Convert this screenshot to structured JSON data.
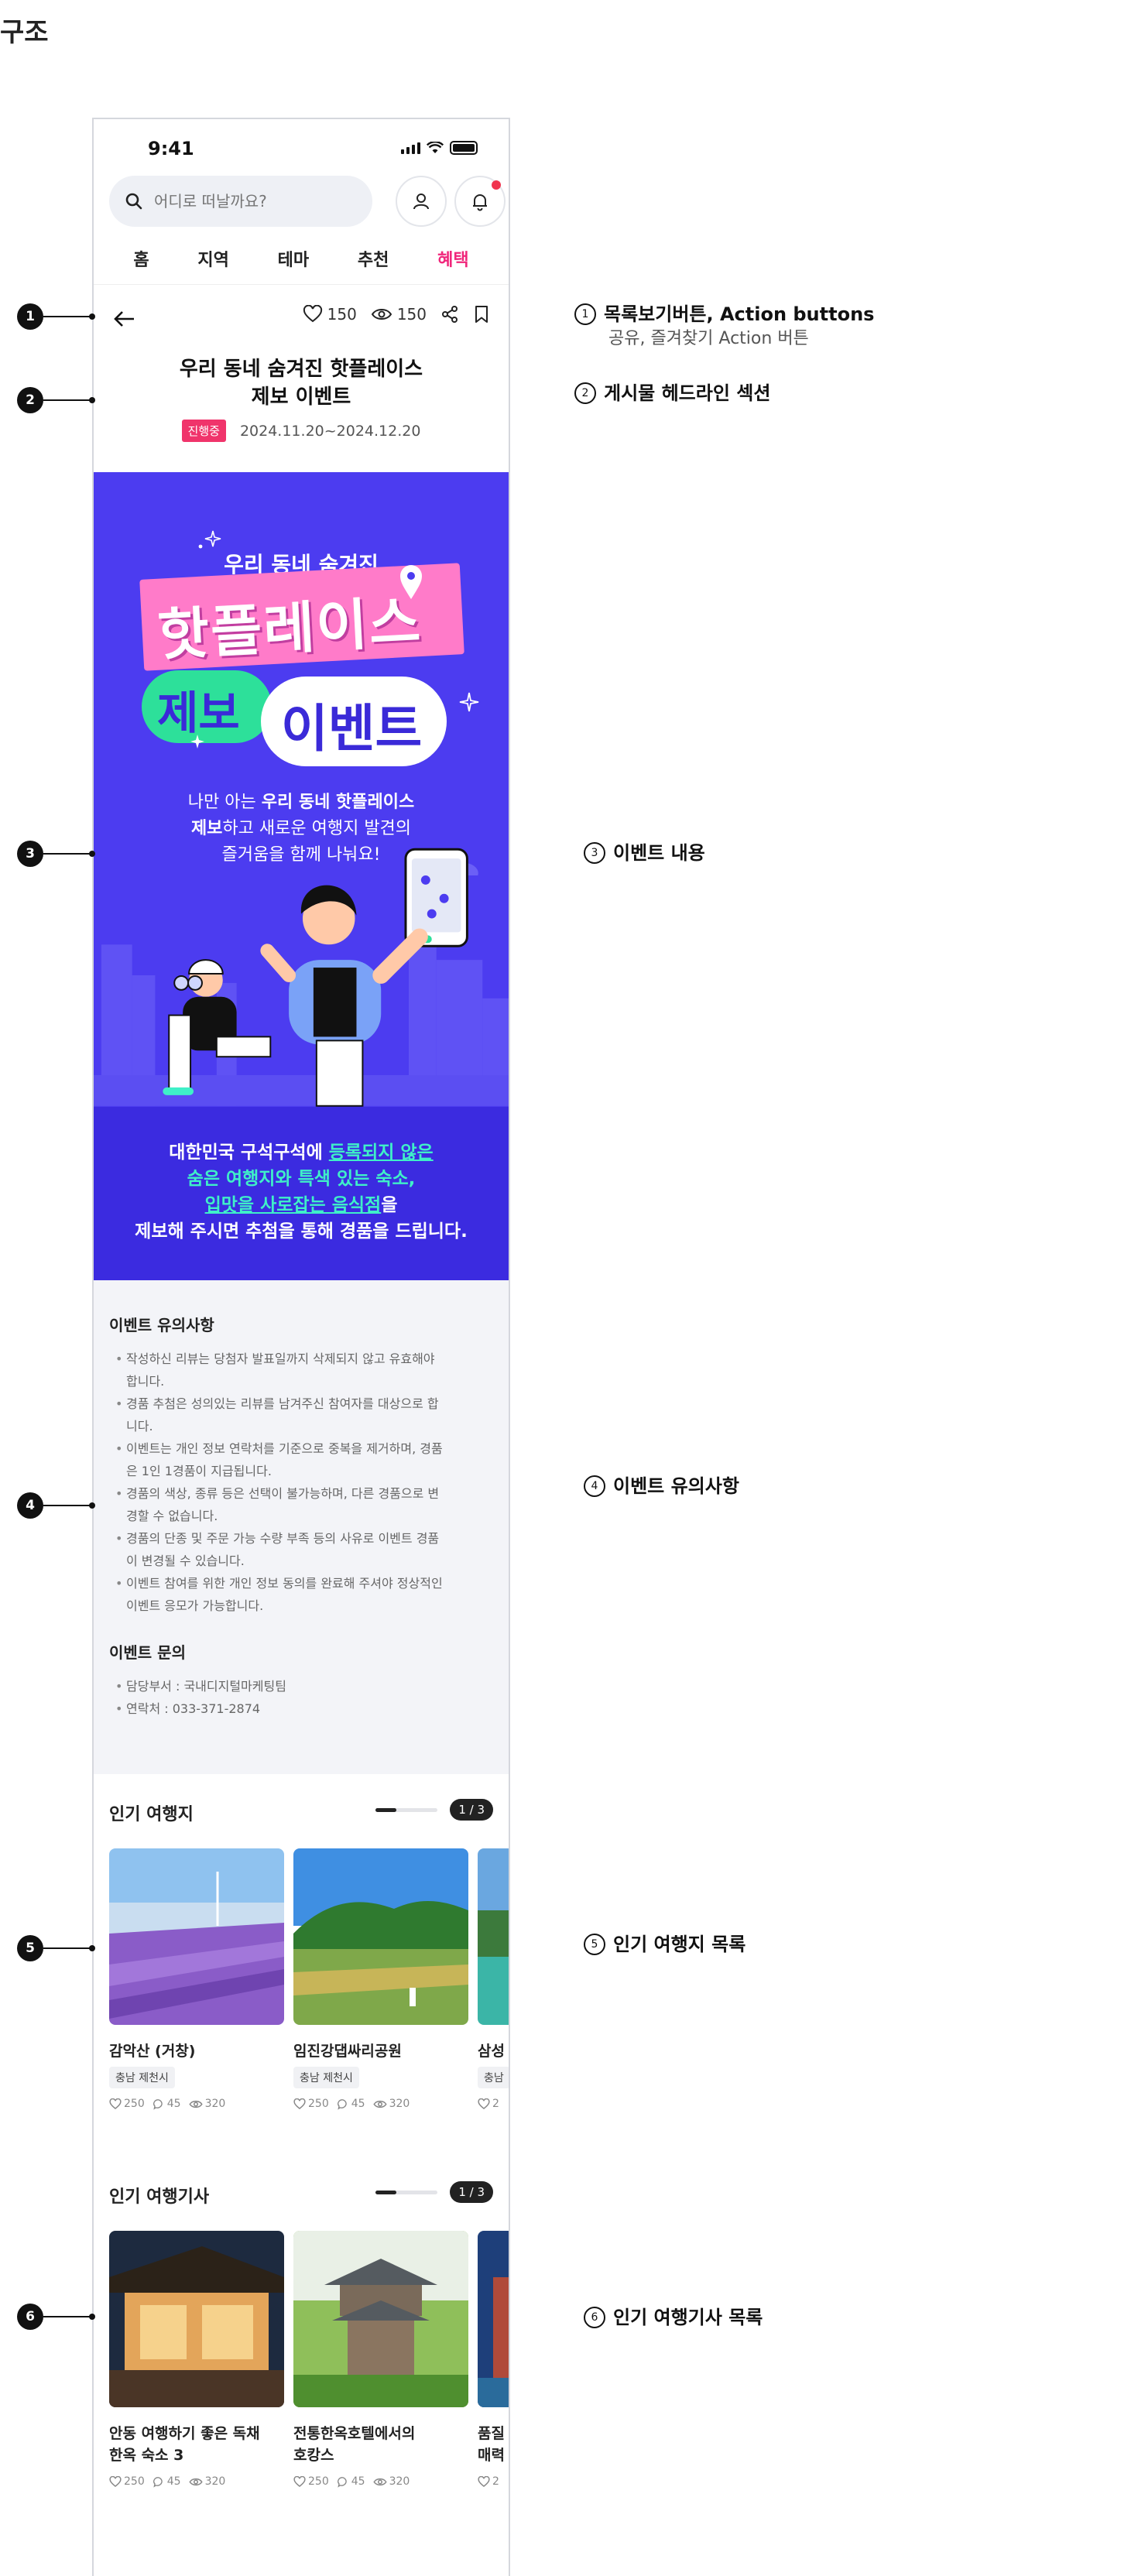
{
  "page_title": "구조",
  "status": {
    "time": "9:41"
  },
  "search": {
    "placeholder": "어디로 떠날까요?"
  },
  "tabs": [
    {
      "label": "홈"
    },
    {
      "label": "지역"
    },
    {
      "label": "테마"
    },
    {
      "label": "추천"
    },
    {
      "label": "혜택"
    }
  ],
  "actions": {
    "likes": "150",
    "views": "150"
  },
  "post": {
    "title_line1": "우리 동네 숨겨진 핫플레이스",
    "title_line2": "제보 이벤트",
    "status_badge": "진행중",
    "dates": "2024.11.20~2024.12.20"
  },
  "banner": {
    "subtitle": "우리 동네 숨겨진",
    "title_pink": "핫플레이스",
    "title_green": "제보",
    "title_cloud": "이벤트",
    "text_line1_pre": "나만 아는 ",
    "text_line1_bold": "우리 동네 핫플레이스",
    "text_line2_bold": "제보",
    "text_line2_rest": "하고  새로운 여행지 발견의",
    "text_line3": "즐거움을 함께 나눠요!",
    "foot_line1_pre": "대한민국 구석구석에 ",
    "foot_line1_hl": "등록되지 않은",
    "foot_line2": "숨은 여행지와 특색 있는 숙소,",
    "foot_line3_hl": "입맛을 사로잡는 음식점",
    "foot_line3_post": "을",
    "foot_line4": "제보해 주시면 추첨을 통해 경품을 드립니다.",
    "colors": {
      "bg": "#4c3cf0",
      "accent_mint": "#3ff0c8",
      "pink": "#ff7bc9"
    }
  },
  "notice": {
    "title": "이벤트 유의사항",
    "items": [
      {
        "l1": "작성하신 리뷰는 당첨자 발표일까지 삭제되지 않고 유효해야",
        "l2": "합니다."
      },
      {
        "l1": "경품 추첨은 성의있는 리뷰를 남겨주신 참여자를 대상으로 합",
        "l2": "니다."
      },
      {
        "l1": "이벤트는 개인 정보 연락처를 기준으로 중복을 제거하며, 경품",
        "l2": "은 1인 1경품이 지급됩니다."
      },
      {
        "l1": "경품의 색상, 종류 등은 선택이 불가능하며, 다른 경품으로 변",
        "l2": "경할 수 없습니다."
      },
      {
        "l1": "경품의 단종 및 주문 가능 수량 부족 등의 사유로 이벤트 경품",
        "l2": "이 변경될 수 있습니다."
      },
      {
        "l1": "이벤트 참여를 위한 개인 정보 동의를 완료해 주셔야 정상적인",
        "l2": "이벤트 응모가 가능합니다."
      }
    ],
    "inquiry_title": "이벤트 문의",
    "inquiry": [
      "담당부서 : 국내디지털마케팅팀",
      "연락처 : 033-371-2874"
    ]
  },
  "popular_places": {
    "title": "인기 여행지",
    "pager": "1 / 3",
    "pager_progress": 0.33,
    "cards": [
      {
        "name": "감악산 (거창)",
        "tag": "충남 제천시",
        "likes": "250",
        "comments": "45",
        "views": "320"
      },
      {
        "name": "임진강댑싸리공원",
        "tag": "충남 제천시",
        "likes": "250",
        "comments": "45",
        "views": "320"
      },
      {
        "name": "삼성",
        "tag": "충남",
        "likes": "2",
        "comments": "",
        "views": ""
      }
    ]
  },
  "popular_articles": {
    "title": "인기 여행기사",
    "pager": "1 / 3",
    "pager_progress": 0.33,
    "cards": [
      {
        "name_l1": "안동 여행하기 좋은 독채",
        "name_l2": "한옥 숙소 3",
        "likes": "250",
        "comments": "45",
        "views": "320"
      },
      {
        "name_l1": "전통한옥호텔에서의",
        "name_l2": "호캉스",
        "likes": "250",
        "comments": "45",
        "views": "320"
      },
      {
        "name_l1": "품질",
        "name_l2": "매력",
        "likes": "2",
        "comments": "",
        "views": ""
      }
    ]
  },
  "callouts": [
    {
      "num": "1",
      "text": "목록보기버튼, Action buttons",
      "sub": "공유, 즐겨찾기  Action 버튼"
    },
    {
      "num": "2",
      "text": "게시물 헤드라인 섹션",
      "sub": ""
    },
    {
      "num": "3",
      "text": "이벤트 내용",
      "sub": ""
    },
    {
      "num": "4",
      "text": "이벤트 유의사항",
      "sub": ""
    },
    {
      "num": "5",
      "text": "인기 여행지 목록",
      "sub": ""
    },
    {
      "num": "6",
      "text": "인기 여행기사 목록",
      "sub": ""
    }
  ]
}
